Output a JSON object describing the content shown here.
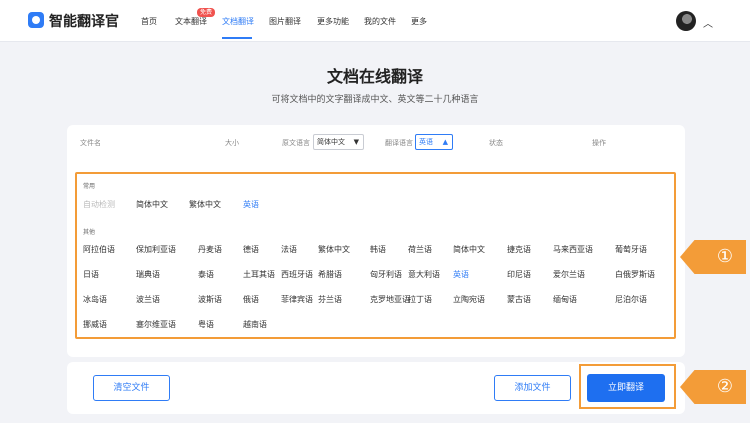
{
  "app": {
    "name": "智能翻译官"
  },
  "nav": {
    "items": [
      "首页",
      "文本翻译",
      "文档翻译",
      "图片翻译",
      "更多功能",
      "我的文件",
      "更多"
    ],
    "active_index": 2,
    "badge": "免费"
  },
  "page": {
    "title": "文档在线翻译",
    "subtitle": "可将文档中的文字翻译成中文、英文等二十几种语言"
  },
  "table": {
    "headers": {
      "filename": "文件名",
      "size": "大小",
      "source_lang": "原文语言",
      "target_lang": "翻译语言",
      "status": "状态",
      "actions": "操作"
    },
    "source_value": "简体中文",
    "target_value": "英语"
  },
  "dropdown": {
    "common_label": "常用",
    "other_label": "其他",
    "common": [
      {
        "name": "自动检测",
        "state": "disabled"
      },
      {
        "name": "简体中文",
        "state": "normal"
      },
      {
        "name": "繁体中文",
        "state": "normal"
      },
      {
        "name": "英语",
        "state": "selected"
      }
    ],
    "other": [
      [
        "阿拉伯语",
        "保加利亚语",
        "丹麦语",
        "德语",
        "法语",
        "繁体中文",
        "韩语",
        "荷兰语",
        "简体中文",
        "捷克语",
        "马来西亚语",
        "葡萄牙语"
      ],
      [
        "日语",
        "瑞典语",
        "泰语",
        "土耳其语",
        "西班牙语",
        "希腊语",
        "匈牙利语",
        "意大利语",
        "英语",
        "印尼语",
        "爱尔兰语",
        "白俄罗斯语"
      ],
      [
        "冰岛语",
        "波兰语",
        "波斯语",
        "俄语",
        "菲律宾语",
        "芬兰语",
        "克罗地亚语",
        "拉丁语",
        "立陶宛语",
        "蒙古语",
        "缅甸语",
        "尼泊尔语"
      ],
      [
        "挪威语",
        "塞尔维亚语",
        "粤语",
        "越南语"
      ]
    ],
    "other_selected": "英语"
  },
  "actions": {
    "clear": "清空文件",
    "add": "添加文件",
    "translate": "立即翻译"
  },
  "steps": [
    "①",
    "②"
  ],
  "colors": {
    "accent": "#2f7cf6",
    "highlight": "#f39c38",
    "badge": "#f0524e"
  }
}
